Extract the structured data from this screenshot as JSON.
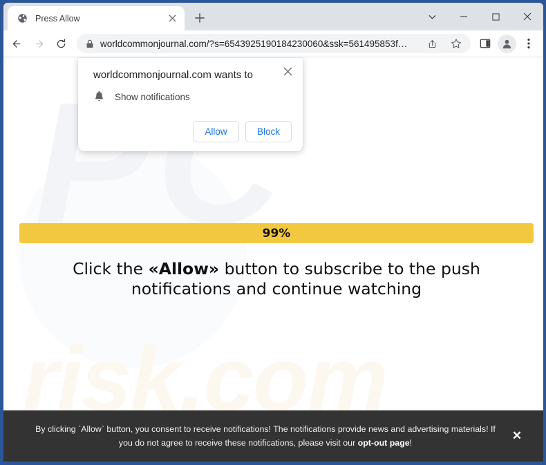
{
  "window": {
    "frame_color": "#2b579a",
    "controls": {
      "tab_search_label": "Tab search",
      "minimize_label": "Minimize",
      "maximize_label": "Maximize",
      "close_label": "Close"
    }
  },
  "tabstrip": {
    "active_tab": {
      "title": "Press Allow",
      "favicon": "globe-icon",
      "close_label": "Close tab"
    },
    "new_tab_label": "New Tab"
  },
  "toolbar": {
    "back_label": "Back",
    "forward_label": "Forward",
    "reload_label": "Reload",
    "omnibox": {
      "security_icon": "lock-icon",
      "url": "worldcommonjournal.com/?s=6543925190184230060&ssk=561495853f…",
      "share_label": "Share this page",
      "bookmark_label": "Bookmark this tab"
    },
    "side_panel_label": "Side panel",
    "profile_label": "Profile",
    "menu_label": "Customize and control Google Chrome"
  },
  "permission_dialog": {
    "title": "worldcommonjournal.com wants to",
    "permission_icon": "bell-icon",
    "permission_label": "Show notifications",
    "allow_label": "Allow",
    "block_label": "Block",
    "close_label": "Close"
  },
  "page": {
    "watermark": {
      "top": "PC",
      "bottom": "risk.com"
    },
    "progress": {
      "percent": 99,
      "label": "99%",
      "fill_color": "#f2c840",
      "track_color": "#f0f0f0"
    },
    "headline": {
      "part1": "Click the ",
      "emphasis": "«Allow»",
      "part2": " button to subscribe to the push notifications and continue watching"
    },
    "consent_banner": {
      "background_color": "#333333",
      "text_part1": "By clicking `Allow` button, you consent to receive notifications! The notifications provide news and advertising materials! If you do not agree to receive these notifications, please visit our ",
      "link_label": "opt-out page",
      "text_part2": "!",
      "close_label": "✕"
    }
  }
}
